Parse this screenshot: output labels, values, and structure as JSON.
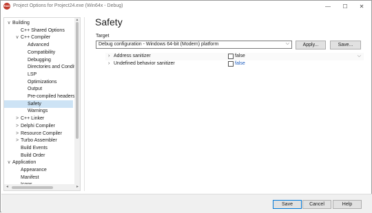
{
  "window": {
    "title": "Project Options for Project24.exe (Win64x - Debug)",
    "app_icon_text": "RAD"
  },
  "titlebar_buttons": {
    "minimize": "—",
    "maximize": "☐",
    "close": "✕"
  },
  "sidebar": {
    "items": [
      {
        "label": "Building",
        "arrow": "∨",
        "indent": 0
      },
      {
        "label": "C++ Shared Options",
        "arrow": "",
        "indent": 1
      },
      {
        "label": "C++ Compiler",
        "arrow": "∨",
        "indent": 1
      },
      {
        "label": "Advanced",
        "arrow": "",
        "indent": 2
      },
      {
        "label": "Compatibility",
        "arrow": "",
        "indent": 2
      },
      {
        "label": "Debugging",
        "arrow": "",
        "indent": 2
      },
      {
        "label": "Directories and Conditionals",
        "arrow": "",
        "indent": 2
      },
      {
        "label": "LSP",
        "arrow": "",
        "indent": 2
      },
      {
        "label": "Optimizations",
        "arrow": "",
        "indent": 2
      },
      {
        "label": "Output",
        "arrow": "",
        "indent": 2
      },
      {
        "label": "Pre-compiled headers",
        "arrow": "",
        "indent": 2
      },
      {
        "label": "Safety",
        "arrow": "",
        "indent": 2,
        "selected": true
      },
      {
        "label": "Warnings",
        "arrow": "",
        "indent": 2
      },
      {
        "label": "C++ Linker",
        "arrow": ">",
        "indent": 1
      },
      {
        "label": "Delphi Compiler",
        "arrow": ">",
        "indent": 1
      },
      {
        "label": "Resource Compiler",
        "arrow": ">",
        "indent": 1
      },
      {
        "label": "Turbo Assembler",
        "arrow": ">",
        "indent": 1
      },
      {
        "label": "Build Events",
        "arrow": "",
        "indent": 1
      },
      {
        "label": "Build Order",
        "arrow": "",
        "indent": 1
      },
      {
        "label": "Application",
        "arrow": "∨",
        "indent": 0
      },
      {
        "label": "Appearance",
        "arrow": "",
        "indent": 1
      },
      {
        "label": "Manifest",
        "arrow": "",
        "indent": 1
      },
      {
        "label": "Icons",
        "arrow": "",
        "indent": 1
      }
    ]
  },
  "main": {
    "page_title": "Safety",
    "target_label": "Target",
    "target_value": "Debug configuration - Windows 64-bit (Modern) platform",
    "apply_label": "Apply...",
    "save_label": "Save...",
    "options": [
      {
        "name": "Address sanitizer",
        "value": "false",
        "checked": false
      },
      {
        "name": "Undefined behavior sanitizer",
        "value": "false",
        "checked": false
      }
    ]
  },
  "footer": {
    "save_label": "Save",
    "cancel_label": "Cancel",
    "help_label": "Help"
  },
  "colors": {
    "selection": "#cde3f5",
    "link_value": "#1f5fbf"
  }
}
